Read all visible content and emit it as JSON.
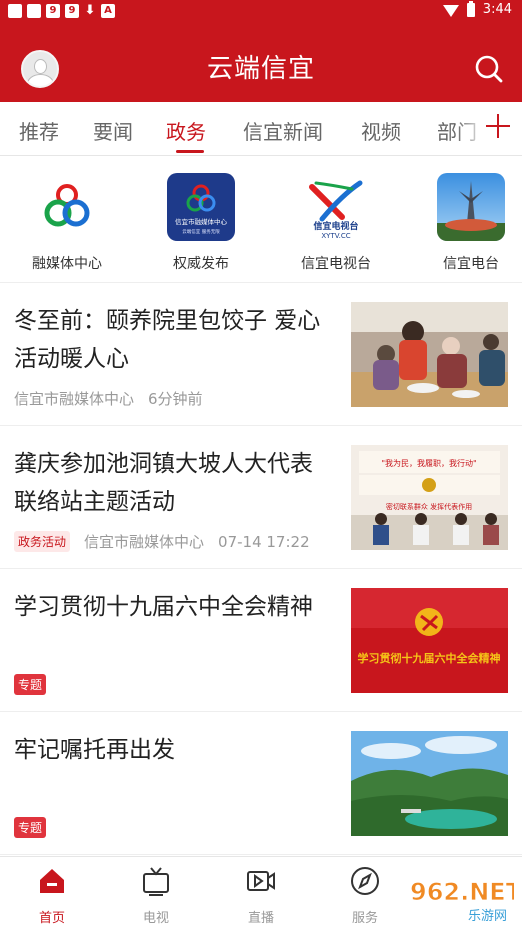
{
  "status_bar": {
    "time": "3:44"
  },
  "header": {
    "title": "云端信宜"
  },
  "tabs": [
    {
      "label": "推荐"
    },
    {
      "label": "要闻"
    },
    {
      "label": "政务"
    },
    {
      "label": "信宜新闻"
    },
    {
      "label": "视频"
    },
    {
      "label": "部门"
    }
  ],
  "active_tab": "政务",
  "channels": [
    {
      "label": "融媒体中心",
      "icon": "rongmeiti-logo"
    },
    {
      "label": "权威发布",
      "icon": "quanwei-logo",
      "logo_text": "信宜市融媒体中心",
      "logo_subtext": "云端信宜  服务无限"
    },
    {
      "label": "信宜电视台",
      "icon": "xytv-logo",
      "logo_text": "信宜电视台",
      "logo_subtext": "XYTV.CC"
    },
    {
      "label": "信宜电台",
      "icon": "radio-tower-photo"
    }
  ],
  "news": [
    {
      "title": "冬至前：颐养院里包饺子 爱心活动暖人心",
      "source": "信宜市融媒体中心",
      "time": "6分钟前",
      "tag": "",
      "thumb": "dumplings-photo"
    },
    {
      "title": "龚庆参加池洞镇大坡人大代表联络站主题活动",
      "source": "信宜市融媒体中心",
      "time": "07-14 17:22",
      "tag": "政务活动",
      "thumb": "meeting-photo",
      "thumb_text_top": "\"我为民，我履职，我行动\"",
      "thumb_text_mid": "密切联系群众     发挥代表作用"
    },
    {
      "title": "学习贯彻十九届六中全会精神",
      "source": "",
      "time": "",
      "tag": "专题",
      "thumb": "party-banner",
      "thumb_text": "学习贯彻十九届六中全会精神"
    },
    {
      "title": "牢记嘱托再出发",
      "source": "",
      "time": "",
      "tag": "专题",
      "thumb": "mountain-lake-photo"
    }
  ],
  "bottom_nav": [
    {
      "label": "首页",
      "icon": "home-icon",
      "active": true
    },
    {
      "label": "电视",
      "icon": "tv-icon",
      "active": false
    },
    {
      "label": "直播",
      "icon": "video-camera-icon",
      "active": false
    },
    {
      "label": "服务",
      "icon": "compass-icon",
      "active": false
    }
  ],
  "watermark": {
    "text": "962.NET",
    "subtext": "乐游网"
  },
  "colors": {
    "brand_red": "#c8161d",
    "tag_bg": "#fde8e8",
    "text_gray": "#999999"
  }
}
